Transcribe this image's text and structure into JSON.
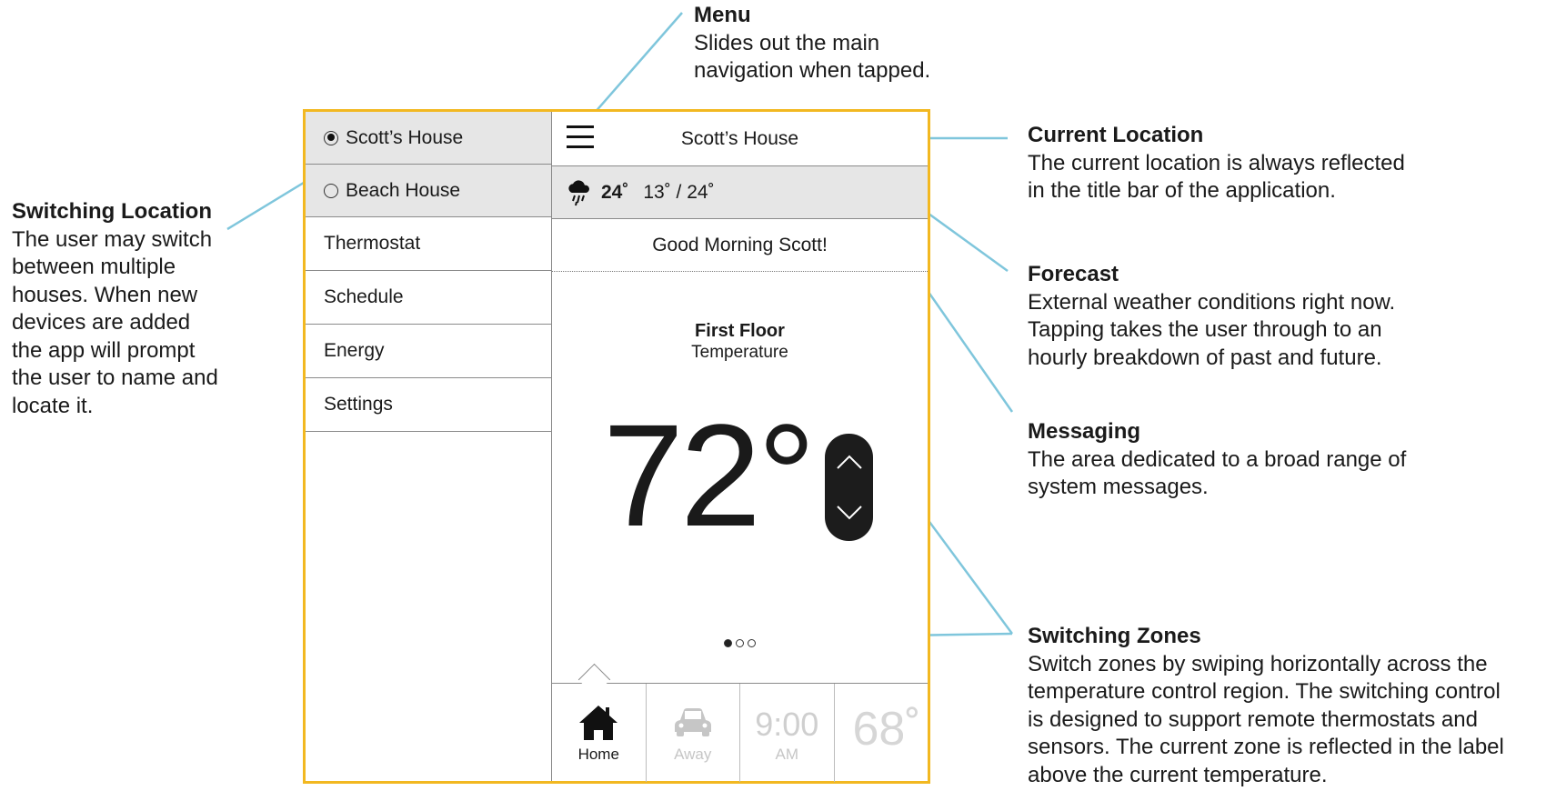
{
  "annotations": {
    "menu": {
      "title": "Menu",
      "body": [
        "Slides out the main",
        "navigation when tapped."
      ]
    },
    "current_location": {
      "title": "Current Location",
      "body": [
        "The current location is always reflected",
        "in the title bar of the application."
      ]
    },
    "forecast": {
      "title": "Forecast",
      "body": [
        "External weather conditions right now.",
        "Tapping takes the user through to an",
        "hourly breakdown of past and future."
      ]
    },
    "messaging": {
      "title": "Messaging",
      "body": [
        "The area dedicated to a broad range of",
        "system messages."
      ]
    },
    "switching_zones": {
      "title": "Switching Zones",
      "body": [
        "Switch zones by swiping horizontally across the",
        "temperature control region. The switching control",
        "is designed to support remote thermostats and",
        "sensors. The current zone is reflected in the label",
        "above the current temperature."
      ]
    },
    "switching_location": {
      "title": "Switching Location",
      "body": [
        "The user may switch",
        "between multiple",
        "houses. When new",
        "devices are added",
        "the app will prompt",
        "the user to name and",
        "locate it."
      ]
    }
  },
  "sidebar": {
    "locations": [
      {
        "label": "Scott’s House",
        "selected": true
      },
      {
        "label": "Beach House",
        "selected": false
      }
    ],
    "items": [
      "Thermostat",
      "Schedule",
      "Energy",
      "Settings"
    ]
  },
  "titlebar": {
    "title": "Scott’s House",
    "menu_icon": "hamburger-menu-icon"
  },
  "forecast": {
    "icon": "rain-cloud-icon",
    "current": "24˚",
    "range": "13˚ / 24˚"
  },
  "message": "Good Morning Scott!",
  "zone": {
    "name": "First Floor",
    "label": "Temperature",
    "temperature": "72°",
    "active_zone_index": 0,
    "zone_count": 3
  },
  "bottom_nav": {
    "home_label": "Home",
    "away_label": "Away",
    "time": "9:00",
    "ampm": "AM",
    "outside_temp": "68˚"
  },
  "colors": {
    "frame": "#f2b821",
    "leader": "#7fc6dc",
    "panel_gray": "#e6e6e6"
  }
}
